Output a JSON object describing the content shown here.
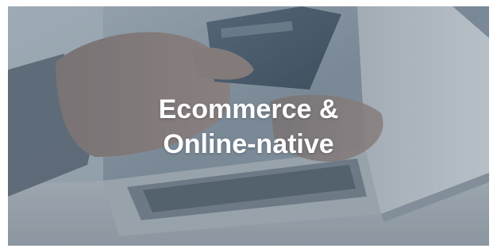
{
  "tile": {
    "title_line1": "Ecommerce &",
    "title_line2": "Online-native",
    "image_subject": "hand-holding-credit-card-over-laptop",
    "overlay_color": "#46586c"
  }
}
